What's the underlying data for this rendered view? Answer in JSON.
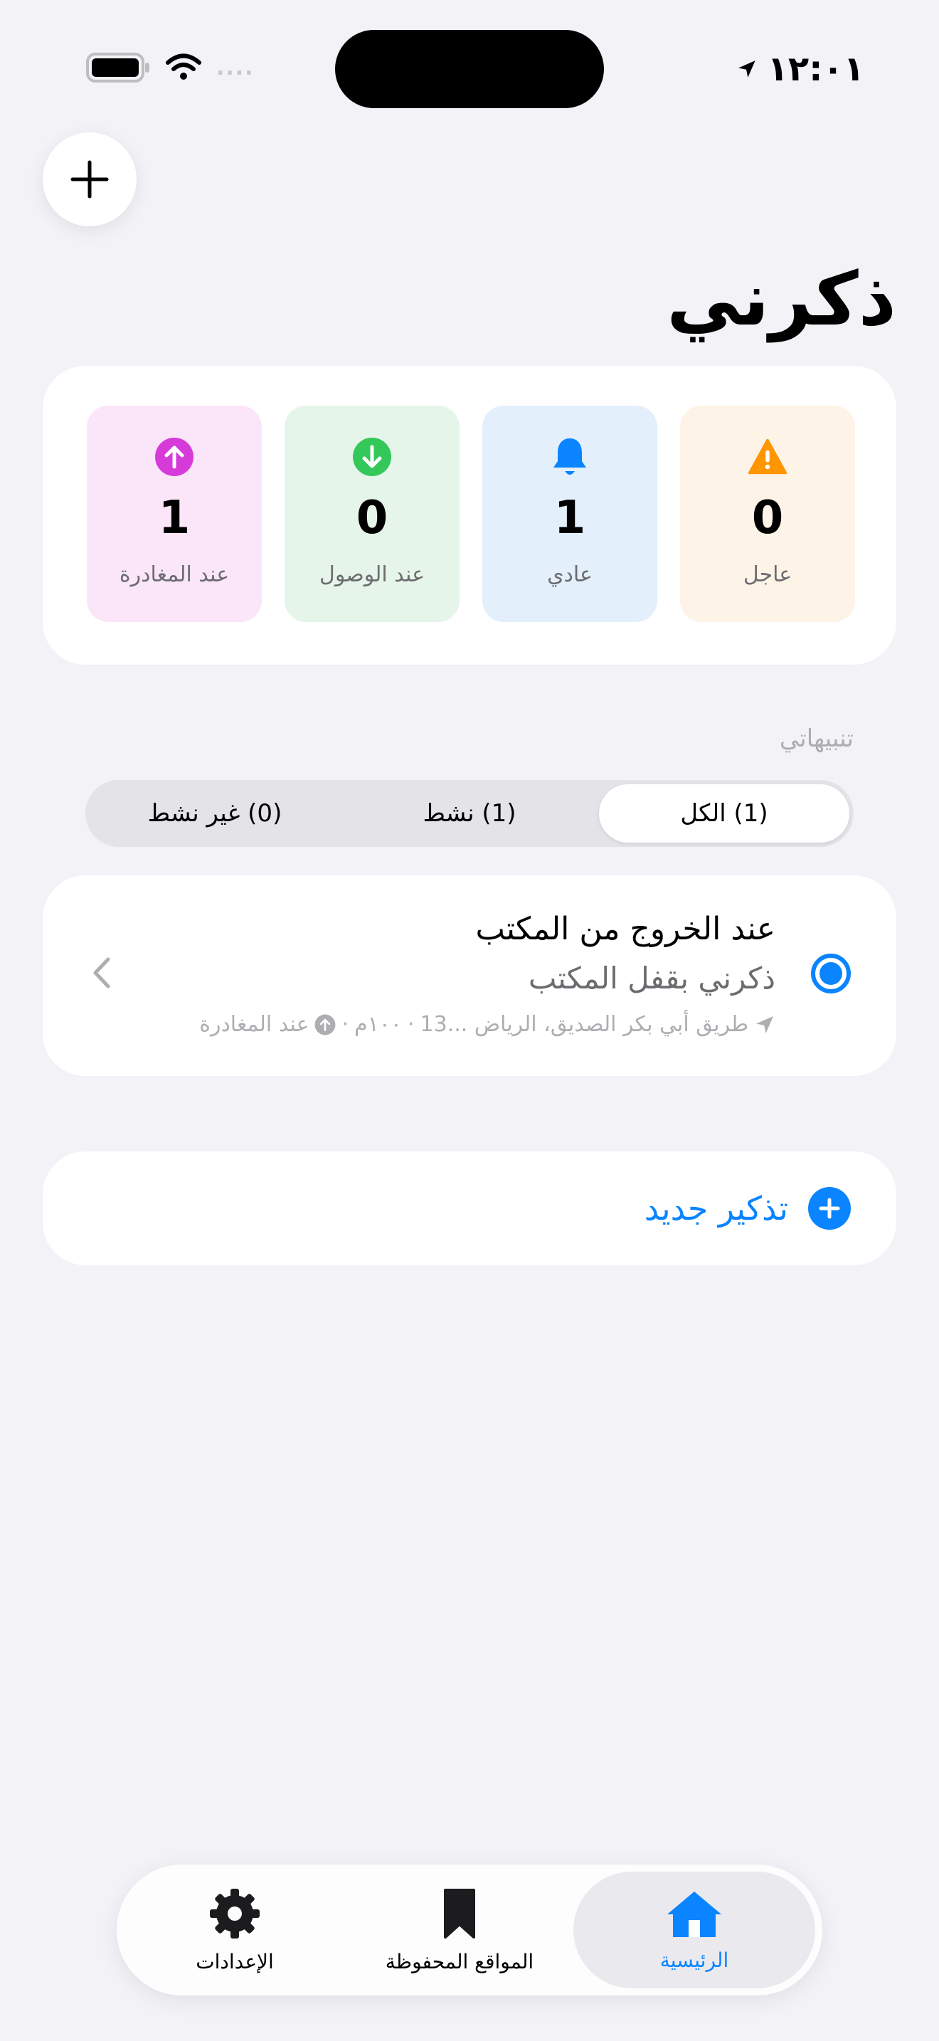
{
  "status_bar": {
    "time": "١٢:٠١"
  },
  "header": {
    "title": "ذكرني",
    "add_icon": "plus-icon"
  },
  "stats": [
    {
      "key": "urgent",
      "value": "0",
      "label": "عاجل",
      "icon": "warning-icon",
      "color": "#ff9500",
      "bg": "#fdf3e7"
    },
    {
      "key": "normal",
      "value": "1",
      "label": "عادي",
      "icon": "bell-icon",
      "color": "#0a84ff",
      "bg": "#e3effb"
    },
    {
      "key": "arrival",
      "value": "0",
      "label": "عند الوصول",
      "icon": "arrow-down-circle-icon",
      "color": "#34c759",
      "bg": "#e6f5ea"
    },
    {
      "key": "departure",
      "value": "1",
      "label": "عند المغادرة",
      "icon": "arrow-up-circle-icon",
      "color": "#d63bd9",
      "bg": "#fae6f8"
    }
  ],
  "alerts_section": {
    "label": "تنبيهاتي"
  },
  "filters": [
    {
      "label": "(1) الكل",
      "active": true
    },
    {
      "label": "(1) نشط",
      "active": false
    },
    {
      "label": "(0) غير نشط",
      "active": false
    }
  ],
  "reminder": {
    "title": "عند الخروج من المكتب",
    "subtitle": "ذكرني بقفل المكتب",
    "location": "طريق أبي بكر الصديق، الرياض ...13",
    "radius": "١٠٠م",
    "trigger": "عند المغادرة"
  },
  "new_reminder": {
    "label": "تذكير جديد"
  },
  "tab_bar": [
    {
      "label": "الرئيسية",
      "icon": "house-icon",
      "active": true
    },
    {
      "label": "المواقع المحفوظة",
      "icon": "bookmark-icon",
      "active": false
    },
    {
      "label": "الإعدادات",
      "icon": "gear-icon",
      "active": false
    }
  ],
  "colors": {
    "accent": "#0a84ff",
    "background": "#f2f2f7"
  }
}
